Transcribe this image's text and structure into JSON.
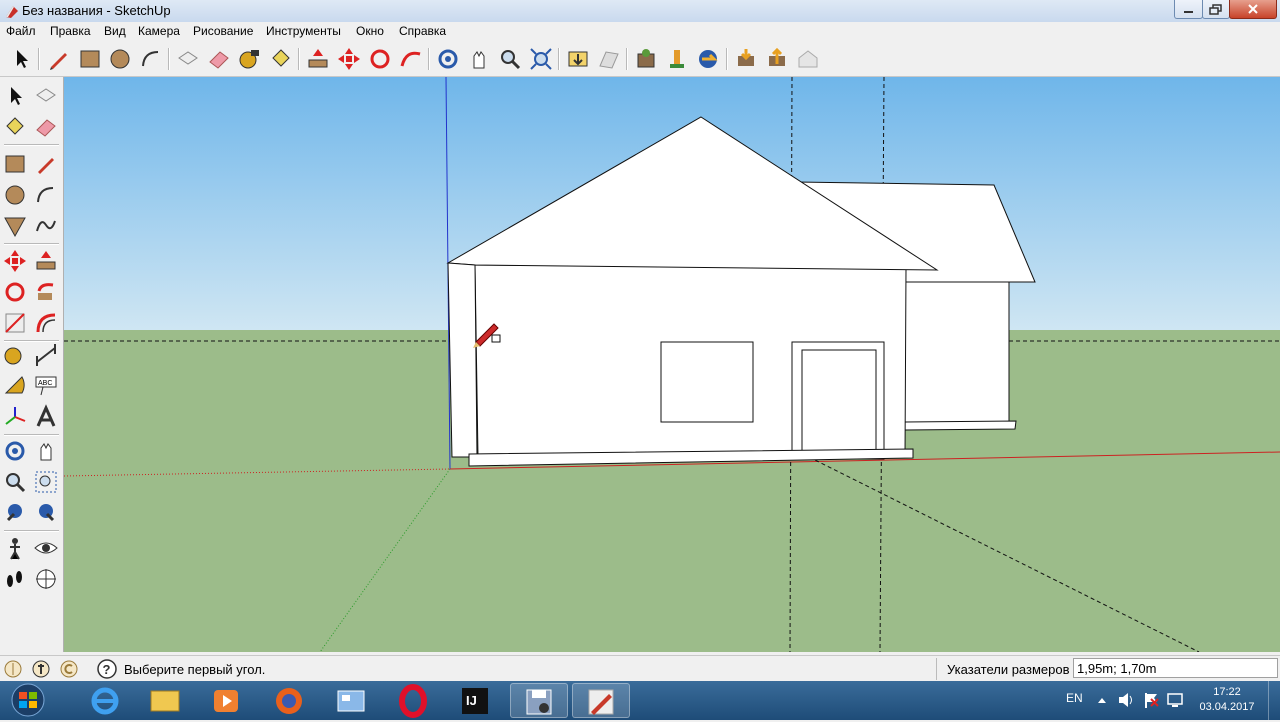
{
  "window": {
    "title": "Без названия - SketchUp"
  },
  "menu": [
    "Файл",
    "Правка",
    "Вид",
    "Камера",
    "Рисование",
    "Инструменты",
    "Окно",
    "Справка"
  ],
  "toolbar_icons": [
    "select-icon",
    "pencil-icon",
    "rectangle-icon",
    "circle-icon",
    "arc-icon",
    "make-component-icon",
    "eraser-icon",
    "tape-measure-icon",
    "paint-bucket-icon",
    "push-pull-icon",
    "move-icon",
    "rotate-icon",
    "follow-me-icon",
    "orbit-icon",
    "pan-icon",
    "zoom-icon",
    "zoom-extents-icon",
    "previous-view-icon",
    "next-view-icon",
    "get-models-icon",
    "share-model-icon",
    "extension-warehouse-icon",
    "get-components-icon",
    "share-component-icon",
    "warehouse-icon"
  ],
  "left_toolbar_icons": [
    "select-icon",
    "make-component-icon",
    "paint-bucket-icon",
    "eraser-icon",
    "rectangle-icon",
    "pencil-icon",
    "circle-icon",
    "arc-icon",
    "polygon-icon",
    "freehand-icon",
    "move-icon",
    "push-pull-icon",
    "rotate-icon",
    "follow-me-icon",
    "scale-icon",
    "offset-icon",
    "tape-measure-icon",
    "dimension-icon",
    "protractor-icon",
    "text-icon",
    "axes-icon",
    "3d-text-icon",
    "orbit-icon",
    "pan-icon",
    "zoom-icon",
    "zoom-window-icon",
    "previous-icon",
    "zoom-extents-icon",
    "position-camera-icon",
    "look-around-icon",
    "walk-icon",
    "section-plane-icon"
  ],
  "status": {
    "message": "Выберите первый угол.",
    "measurements_label": "Указатели размеров",
    "measurements_value": "1,95m; 1,70m"
  },
  "taskbar": {
    "language": "EN",
    "time": "17:22",
    "date": "03.04.2017"
  },
  "colors": {
    "sky_top": "#6fb6ea",
    "sky_bottom": "#cfe6f3",
    "ground": "#9cbc8a",
    "axis_red": "#cc2222",
    "axis_green": "#2a9a2a",
    "axis_blue": "#2233cc"
  }
}
